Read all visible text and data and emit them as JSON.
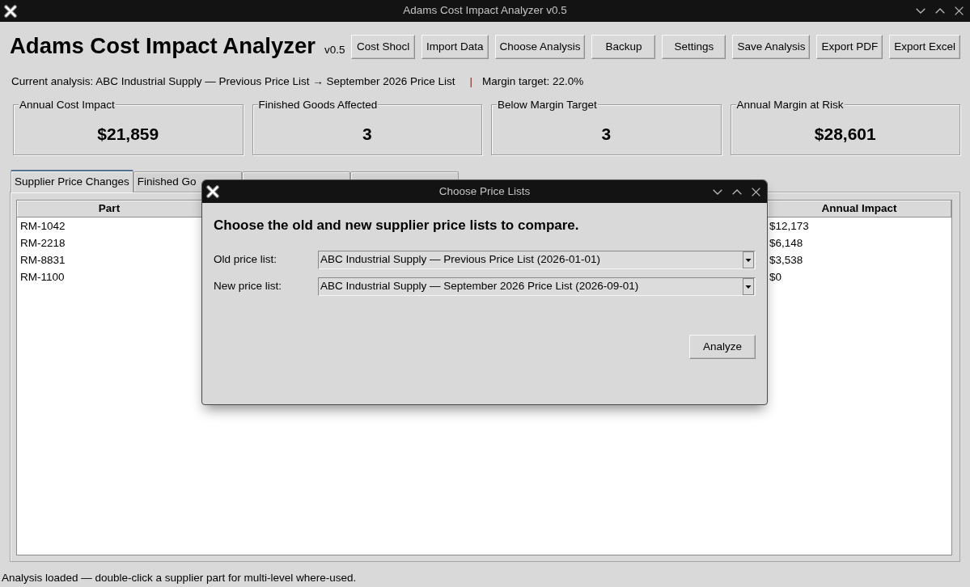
{
  "window": {
    "title": "Adams Cost Impact Analyzer v0.5"
  },
  "header": {
    "app_name": "Adams Cost Impact Analyzer",
    "version": "v0.5"
  },
  "toolbar": {
    "buttons": [
      "Cost Shocl",
      "Import Data",
      "Choose Analysis",
      "Backup",
      "Settings",
      "Save Analysis",
      "Export PDF",
      "Export Excel"
    ]
  },
  "analysis_bar": {
    "current_analysis": "Current analysis: ABC Industrial Supply — Previous Price List → September 2026 Price List",
    "separator": "|",
    "margin_target": "Margin target: 22.0%"
  },
  "kpis": [
    {
      "label": "Annual Cost Impact",
      "value": "$21,859"
    },
    {
      "label": "Finished Goods Affected",
      "value": "3"
    },
    {
      "label": "Below Margin Target",
      "value": "3"
    },
    {
      "label": "Annual Margin at Risk",
      "value": "$28,601"
    }
  ],
  "tabs": [
    {
      "label": "Supplier Price Changes",
      "selected": true
    },
    {
      "label": "Finished Go",
      "selected": false
    },
    {
      "selected": false
    },
    {
      "selected": false
    }
  ],
  "table": {
    "columns": [
      "Part",
      "Annual Impact"
    ],
    "rows": [
      {
        "part": "RM-1042",
        "annual_impact": "$12,173"
      },
      {
        "part": "RM-2218",
        "annual_impact": "$6,148"
      },
      {
        "part": "RM-8831",
        "annual_impact": "$3,538"
      },
      {
        "part": "RM-1100",
        "annual_impact": "$0"
      }
    ]
  },
  "status_bar": {
    "text": "Analysis loaded — double-click a supplier part for multi-level where-used."
  },
  "dialog": {
    "title": "Choose Price Lists",
    "heading": "Choose the old and new supplier price lists to compare.",
    "fields": [
      {
        "label": "Old price list:",
        "value": "ABC Industrial Supply — Previous Price List (2026-01-01)"
      },
      {
        "label": "New price list:",
        "value": "ABC Industrial Supply — September 2026 Price List (2026-09-01)"
      }
    ],
    "buttons": [
      "Analyze"
    ]
  }
}
